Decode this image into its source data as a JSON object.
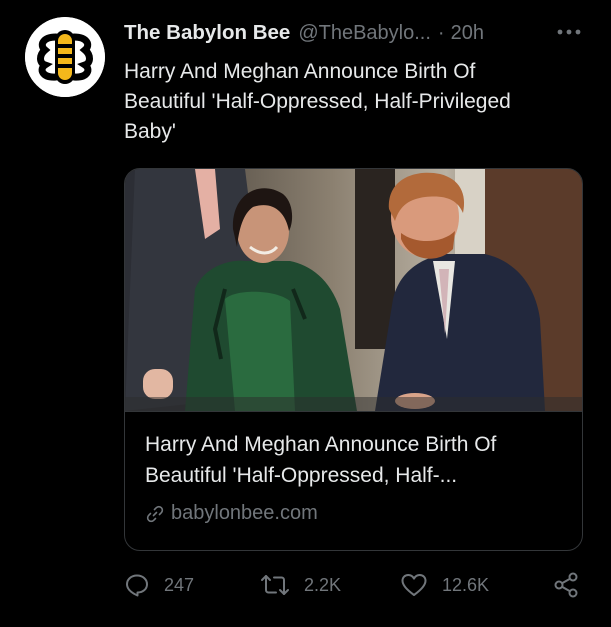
{
  "tweet": {
    "display_name": "The Babylon Bee",
    "handle": "@TheBabylo...",
    "separator": "·",
    "time": "20h",
    "text_lines": [
      "Harry And Meghan Announce Birth Of",
      "Beautiful 'Half-Oppressed, Half-Privileged",
      "Baby'"
    ]
  },
  "card": {
    "title_lines": [
      "Harry And Meghan Announce Birth Of",
      "Beautiful 'Half-Oppressed, Half-..."
    ],
    "domain": "babylonbee.com",
    "image_icon": "photo-of-couple"
  },
  "actions": {
    "replies": "247",
    "retweets": "2.2K",
    "likes": "12.6K"
  },
  "icons": {
    "avatar": "babylon-bee-logo-icon",
    "more": "more-dots-icon",
    "link": "link-icon",
    "reply": "reply-icon",
    "retweet": "retweet-icon",
    "like": "heart-icon",
    "share": "share-icon"
  },
  "colors": {
    "background": "#000000",
    "text": "#e7e9ea",
    "secondary": "#71767b",
    "border": "#333639",
    "logo_yellow": "#f4b81b"
  }
}
